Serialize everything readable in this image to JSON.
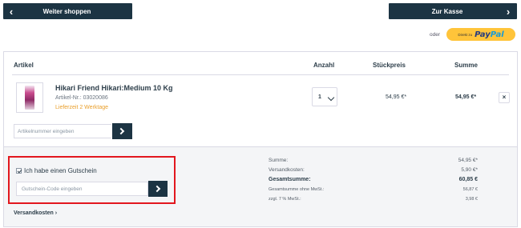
{
  "nav": {
    "back_label": "Weiter shoppen",
    "checkout_label": "Zur Kasse",
    "chev_left": "‹",
    "chev_right": "›"
  },
  "paypal": {
    "or_text": "oder",
    "prefix": "Direkt zu",
    "brand_pay": "Pay",
    "brand_pal": "Pal"
  },
  "table": {
    "col_article": "Artikel",
    "col_qty": "Anzahl",
    "col_unit": "Stückpreis",
    "col_sum": "Summe"
  },
  "item": {
    "name": "Hikari Friend Hikari:Medium 10 Kg",
    "sku": "Artikel-Nr.: 03020086",
    "delivery": "Lieferzeit 2 Werktage",
    "quantity": "1",
    "unit_price": "54,95 €*",
    "total": "54,95 €*",
    "remove": "×"
  },
  "article_input": {
    "placeholder": "Artikelnummer eingeben"
  },
  "voucher": {
    "label": "Ich habe einen Gutschein",
    "placeholder": "Gutschein-Code eingeben",
    "checked": true
  },
  "shipping_link": "Versandkosten ›",
  "summary": [
    {
      "label": "Summe:",
      "value": "54,95 €*"
    },
    {
      "label": "Versandkosten:",
      "value": "5,90 €*"
    },
    {
      "label": "Gesamtsumme:",
      "value": "60,85 €"
    },
    {
      "label": "Gesamtsumme ohne MwSt.:",
      "value": "56,87 €"
    },
    {
      "label": "zzgl. 7 % MwSt.:",
      "value": "3,98 €"
    }
  ],
  "colors": {
    "primary": "#1c3443",
    "accent": "#e99f2b",
    "highlight": "#e2171e",
    "paypal": "#ffc43a"
  }
}
